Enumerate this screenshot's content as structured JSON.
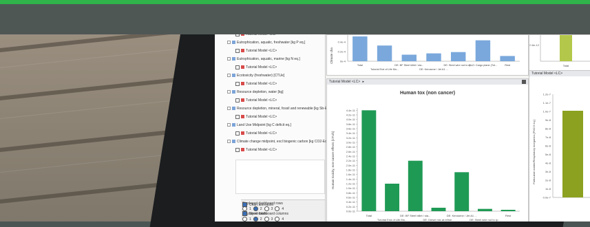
{
  "tree": {
    "items": [
      {
        "label": "Tutorial Model <LC>",
        "indent": 2
      },
      {
        "label": "Eutrophication, aquatic, freshwater [kg P eq.]",
        "indent": 1
      },
      {
        "label": "Tutorial Model <LC>",
        "indent": 2
      },
      {
        "label": "Eutrophication, aquatic, marine [kg N eq.]",
        "indent": 1
      },
      {
        "label": "Tutorial Model <LC>",
        "indent": 2
      },
      {
        "label": "Ecotoxicity (freshwater) [CTUe]",
        "indent": 1
      },
      {
        "label": "Tutorial Model <LC>",
        "indent": 2
      },
      {
        "label": "Resource depletion, water [kg]",
        "indent": 1
      },
      {
        "label": "Tutorial Model <LC>",
        "indent": 2
      },
      {
        "label": "Resource depletion, mineral, fossil and renewable [kg Sb-Equiv.]",
        "indent": 1
      },
      {
        "label": "Tutorial Model <LC>",
        "indent": 2
      },
      {
        "label": "Land Use Midpoint [kg C deficit eq.]",
        "indent": 1
      },
      {
        "label": "Tutorial Model <LC>",
        "indent": 2
      },
      {
        "label": "Climate change midpoint, excl biogenic carbon [kg CO2-Equiv.]",
        "indent": 1
      },
      {
        "label": "Tutorial Model <LC>",
        "indent": 2
      }
    ]
  },
  "settings": {
    "rows_label": "Displayed dashboard rows",
    "rows_options": [
      "1",
      "2",
      "3",
      "4"
    ],
    "columns_label": "Displayed dashboard columns",
    "columns_options": [
      "1",
      "2",
      "3",
      "4"
    ],
    "chart_animation": "Chart animation",
    "show_totals": "Show totals"
  },
  "top_panel": {
    "ylabel": "Climate cha",
    "bar_color": "#7aa8dc",
    "x_labels": [
      "Total",
      "DE: BF Steel billet / sla...",
      "DE: Steel wire rod to rp...",
      "GLO: Cargo plane (Tot...",
      "Rest"
    ],
    "x_labels2": [
      "Tutorial End of Life Mo...",
      "DE: Kerosene / Jet A1 ...",
      "",
      "",
      ""
    ]
  },
  "top_right_panel": {
    "tick": "0.6e-12",
    "bar_color": "#b3c84a",
    "x_label": "Total"
  },
  "main_panel": {
    "header": "Tutorial Model <LC>",
    "bar_color": "#1f9a55"
  },
  "right_panel": {
    "header": "Tutorial Model <LC>",
    "ylabel": "Particulate matter/Respiratory inorganics [PM2.5 eq.]",
    "bar_color": "#8ba11f",
    "ticks": [
      "1.2e-7",
      "1.1e-7",
      "1.0e-7",
      "9e-8",
      "8e-8",
      "7e-8",
      "6e-8",
      "5e-8",
      "4e-8",
      "3e-8",
      "2e-8",
      "1e-8",
      "0.0e-7"
    ]
  },
  "chart_data": [
    {
      "type": "bar",
      "title": "Human tox (non cancer)",
      "ylabel": "Human toxicity, non-cancer effects [CTUh]",
      "categories": [
        "Total",
        "Tutorial End of Life Mo...",
        "DE: BF Steel billet / sla...",
        "DE: Diesel mix at refine...",
        "DE: Kerosene / Jet A1 ...",
        "DE: Steel wire rod to rp...",
        "Rest"
      ],
      "x_labels_top": [
        "Total",
        "DE: BF Steel billet / sla...",
        "DE: Kerosene / Jet A1 ...",
        "Rest"
      ],
      "x_labels_bottom": [
        "Tutorial End of Life Mo...",
        "DE: Diesel mix at refine...",
        "DE: Steel wire rod to rp..."
      ],
      "values": [
        4.4e-11,
        1.2e-11,
        2.2e-11,
        1.5e-12,
        1.7e-11,
        1e-12,
        6e-13
      ],
      "yticks": [
        "0.0e-11",
        "0.2e-11",
        "0.4e-11",
        "0.6e-11",
        "0.8e-11",
        "1.0e-11",
        "1.2e-11",
        "1.4e-11",
        "1.6e-11",
        "1.8e-11",
        "2.0e-11",
        "2.2e-11",
        "2.4e-11",
        "2.6e-11",
        "2.8e-11",
        "3.0e-11",
        "3.2e-11",
        "3.4e-11",
        "3.6e-11",
        "3.8e-11",
        "4.0e-11",
        "4.2e-11",
        "4.4e-11"
      ],
      "ylim": [
        0,
        4.5e-11
      ]
    },
    {
      "type": "bar",
      "ylabel": "Climate cha",
      "categories": [
        "Total",
        "Tutorial End of Life Mo...",
        "DE: BF Steel billet / sla...",
        "DE: Kerosene / Jet A1 ...",
        "DE: Steel wire rod to rp...",
        "GLO: Cargo plane (Tot...",
        "Rest"
      ],
      "values": [
        0.95,
        0.6,
        0.25,
        0.3,
        0.35,
        0.8,
        0.2
      ],
      "yticks": [
        "0.4e-4",
        "0.2e-4",
        "0e-4"
      ]
    }
  ]
}
